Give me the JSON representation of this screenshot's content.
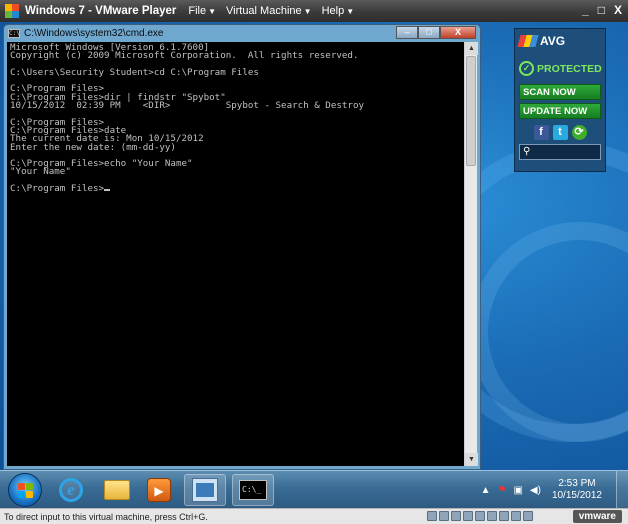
{
  "vmware": {
    "title": "Windows 7 - VMware Player",
    "menu": [
      "File",
      "Virtual Machine",
      "Help"
    ],
    "controls": {
      "minimize": "_",
      "maximize": "□",
      "close": "X"
    }
  },
  "cmd_window": {
    "title": "C:\\Windows\\system32\\cmd.exe",
    "icon_text": "C:\\",
    "buttons": {
      "minimize": "–",
      "maximize": "□",
      "close": "X"
    },
    "console_text": "Microsoft Windows [Version 6.1.7600]\nCopyright (c) 2009 Microsoft Corporation.  All rights reserved.\n\nC:\\Users\\Security Student>cd C:\\Program Files\n\nC:\\Program Files>\nC:\\Program Files>dir | findstr \"Spybot\"\n10/15/2012  02:39 PM    <DIR>          Spybot - Search & Destroy\n\nC:\\Program Files>\nC:\\Program Files>date\nThe current date is: Mon 10/15/2012\nEnter the new date: (mm-dd-yy)\n\nC:\\Program Files>echo \"Your Name\"\n\"Your Name\"\n\nC:\\Program Files>"
  },
  "avg_gadget": {
    "brand": "AVG",
    "status": "PROTECTED",
    "scan_now": "SCAN NOW",
    "update_now": "UPDATE NOW",
    "social": [
      "f",
      "t",
      "⟳"
    ],
    "search_icon": "magnifier-icon"
  },
  "taskbar": {
    "clock_time": "2:53 PM",
    "clock_date": "10/15/2012",
    "tray_arrow": "▲",
    "media_label": "▶",
    "cmd_label": "C:\\_"
  },
  "statusbar": {
    "text": "To direct input to this virtual machine, press Ctrl+G.",
    "brand": "vmware"
  },
  "colors": {
    "avg_green": "#7ee85c",
    "avg_button": "#2faa3a",
    "desktop_blue": "#1a6bb5"
  }
}
